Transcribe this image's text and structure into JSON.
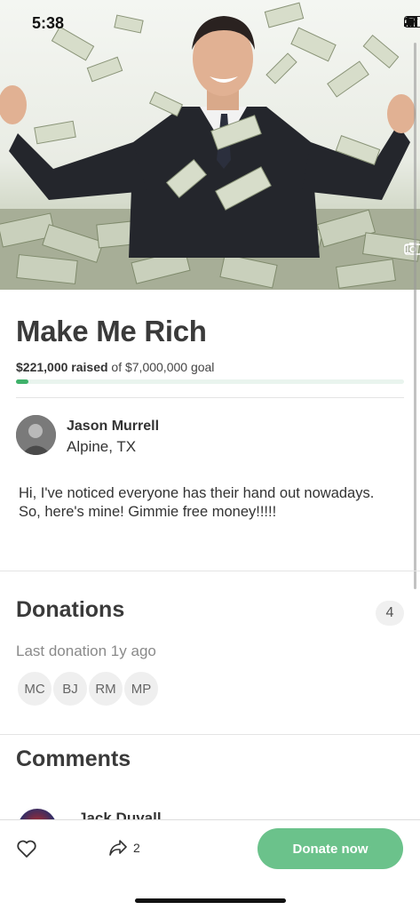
{
  "status_bar": {
    "time": "5:38"
  },
  "hero": {
    "photo_count": "1",
    "image_icon": "camera-icon"
  },
  "campaign": {
    "title": "Make Me Rich",
    "raised_amount": "$221,000 raised",
    "goal_text": "of $7,000,000 goal",
    "progress_fraction": 0.032,
    "progress_color": "#3fb16a"
  },
  "organizer": {
    "name": "Jason Murrell",
    "location": "Alpine, TX"
  },
  "story": "Hi, I've noticed everyone has their hand out nowadays. So, here's mine! Gimmie free money!!!!!",
  "donations": {
    "title": "Donations",
    "count": "4",
    "last_donation": "Last donation 1y ago",
    "donors": [
      "MC",
      "BJ",
      "RM",
      "MP"
    ]
  },
  "comments": {
    "title": "Comments",
    "first_commenter": "Jack Duvall"
  },
  "bottom_bar": {
    "share_count": "2",
    "donate_label": "Donate now",
    "donate_color": "#6bc28b"
  }
}
